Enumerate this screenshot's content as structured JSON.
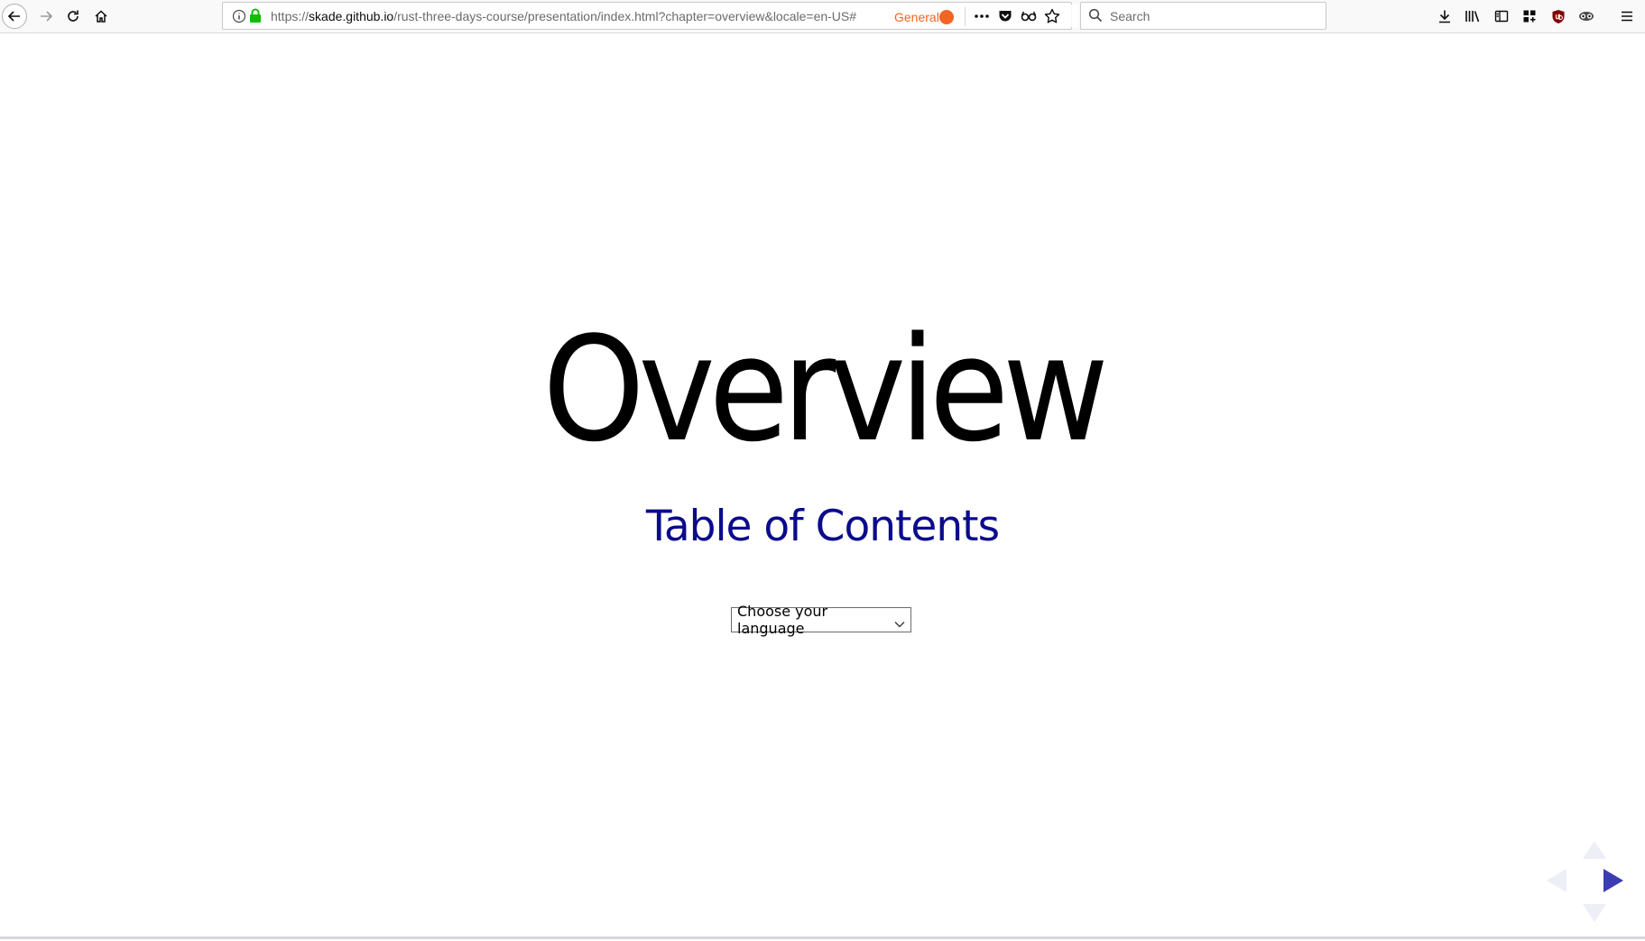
{
  "browser": {
    "url": {
      "protocol": "https://",
      "host": "skade.github.io",
      "path": "/rust-three-days-course/presentation/index.html?chapter=overview&locale=en-US#"
    },
    "container_label": "General",
    "search_placeholder": "Search",
    "colors": {
      "container": "#f26522",
      "secure_lock": "#12bc00"
    },
    "icons": {
      "nav": [
        "back-arrow-icon",
        "forward-arrow-icon",
        "reload-icon",
        "home-icon"
      ],
      "url": [
        "info-icon",
        "lock-icon",
        "page-actions-icon",
        "pocket-icon",
        "reader-icon",
        "bookmark-star-icon"
      ],
      "right": [
        "downloads-icon",
        "library-icon",
        "sidebar-icon",
        "extension-grid-icon",
        "ublock-icon",
        "privacy-badger-icon",
        "hamburger-menu-icon"
      ]
    }
  },
  "slide": {
    "title": "Overview",
    "toc_link": "Table of Contents",
    "language_select": {
      "selected": "Choose your language"
    },
    "colors": {
      "title": "#000000",
      "toc_link": "#0b0b8c",
      "nav_active": "#3c3cb4",
      "nav_inactive": "#eeeef6"
    }
  }
}
